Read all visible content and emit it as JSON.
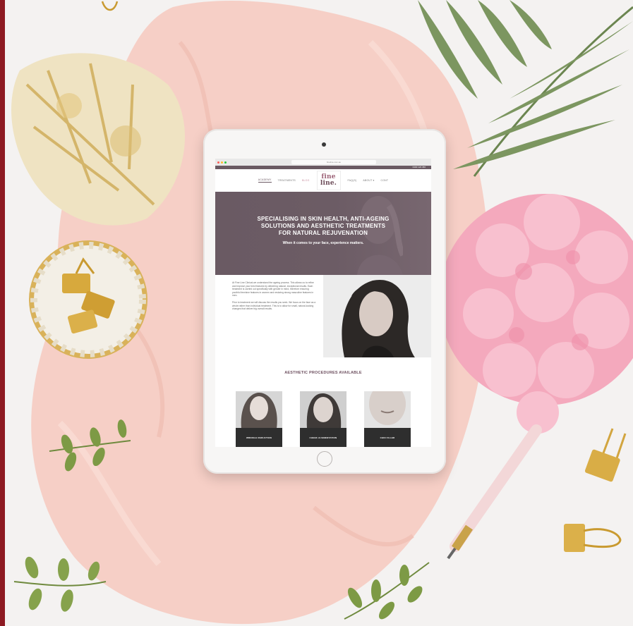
{
  "colors": {
    "brand_stripe": "#8d1a22",
    "hero_bg": "#6a5a63",
    "heading_accent": "#6e5060",
    "card_label_bg": "#2e2e2e"
  },
  "browser": {
    "url": "fineline.com.au",
    "topbar_text": "0400 123 456"
  },
  "nav": {
    "left_items": [
      "ACADEMY",
      "TREATMENTS",
      "BLOG"
    ],
    "right_items": [
      "FAQ(S)",
      "ABOUT ▾",
      "CONT"
    ],
    "logo_line1": "fine",
    "logo_line2": "line."
  },
  "hero": {
    "heading": "SPECIALISING IN SKIN HEALTH, ANTI-AGEING SOLUTIONS AND AESTHETIC TREATMENTS FOR NATURAL REJUVENATION",
    "subheading": "When it comes to your face, experience matters."
  },
  "intro": {
    "paragraph1": "At Fine Line Clinical we understand the ageing process. This allows us to refine and improve your best features by delivering natural, exceptional results. Each treatment is carried out specifically with gender in mind, therefore ensuring youthful feminine features in women and restoring strong masculine features in men.",
    "paragraph2": "Prior to treatment we will discuss the results you seek. We focus on the face as a whole rather than individual treatment. This is to allow for small, natural-looking changes that deliver big overall results."
  },
  "procedures": {
    "title": "AESTHETIC PROCEDURES AVAILABLE",
    "cards": [
      {
        "label": "WRINKLE REDUCTION"
      },
      {
        "label": "CHEEK AUGMENTATION"
      },
      {
        "label": "CHIN FILLER"
      }
    ]
  }
}
